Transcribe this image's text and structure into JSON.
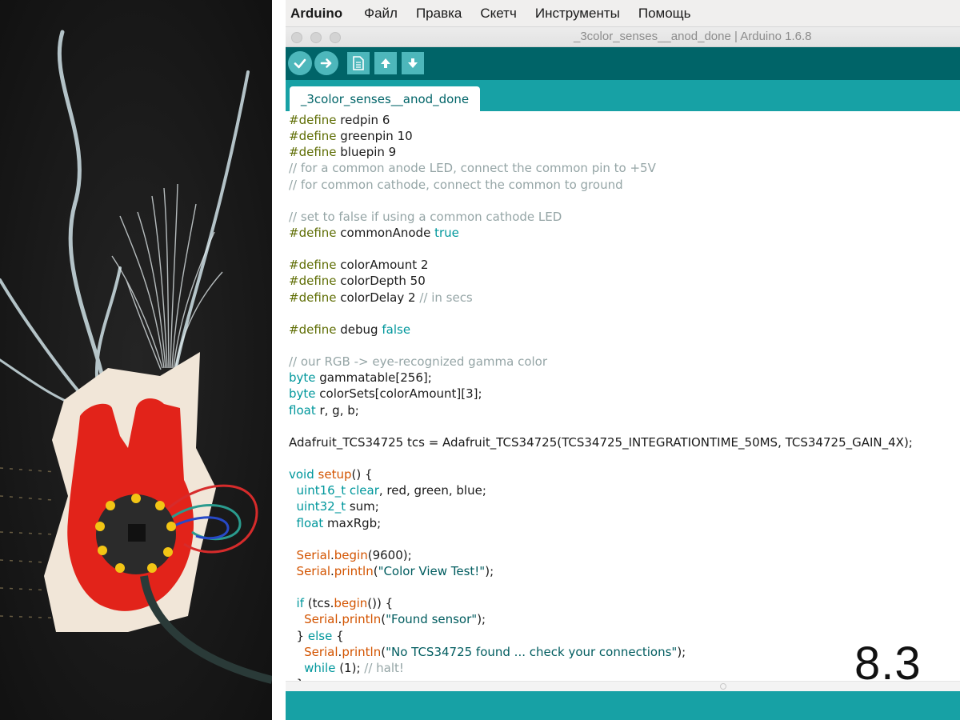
{
  "menubar": {
    "app": "Arduino",
    "items": [
      "Файл",
      "Правка",
      "Скетч",
      "Инструменты",
      "Помощь"
    ]
  },
  "window": {
    "title": "_3color_senses__anod_done | Arduino 1.6.8"
  },
  "toolbar": {
    "buttons": [
      {
        "name": "verify",
        "icon": "check-icon"
      },
      {
        "name": "upload",
        "icon": "arrow-right-icon"
      },
      {
        "name": "new",
        "icon": "file-icon"
      },
      {
        "name": "open",
        "icon": "arrow-up-icon"
      },
      {
        "name": "save",
        "icon": "arrow-down-icon"
      }
    ]
  },
  "tab": {
    "label": "_3color_senses__anod_done"
  },
  "code": [
    "#define redpin 6",
    "#define greenpin 10",
    "#define bluepin 9",
    "// for a common anode LED, connect the common pin to +5V",
    "// for common cathode, connect the common to ground",
    "",
    "// set to false if using a common cathode LED",
    "#define commonAnode true",
    "",
    "#define colorAmount 2",
    "#define colorDepth 50",
    "#define colorDelay 2 // in secs",
    "",
    "#define debug false",
    "",
    "// our RGB -> eye-recognized gamma color",
    "byte gammatable[256];",
    "byte colorSets[colorAmount][3];",
    "float r, g, b;",
    "",
    "Adafruit_TCS34725 tcs = Adafruit_TCS34725(TCS34725_INTEGRATIONTIME_50MS, TCS34725_GAIN_4X);",
    "",
    "void setup() {",
    "  uint16_t clear, red, green, blue;",
    "  uint32_t sum;",
    "  float maxRgb;",
    "",
    "  Serial.begin(9600);",
    "  Serial.println(\"Color View Test!\");",
    "",
    "  if (tcs.begin()) {",
    "    Serial.println(\"Found sensor\");",
    "  } else {",
    "    Serial.println(\"No TCS34725 found ... check your connections\");",
    "    while (1); // halt!",
    "  }"
  ],
  "step_number": "8.3",
  "colors": {
    "toolbar_bg": "#006468",
    "tabstrip_bg": "#17a1a5",
    "button_bg": "#4db7bb",
    "preprocessor": "#5e6d03",
    "comment": "#95a5a6",
    "keyword": "#00979c",
    "function": "#d35400",
    "string": "#005c5f"
  },
  "photo": {
    "subject": "felt heart with Flora board, LEDs and fiber optic strands"
  }
}
